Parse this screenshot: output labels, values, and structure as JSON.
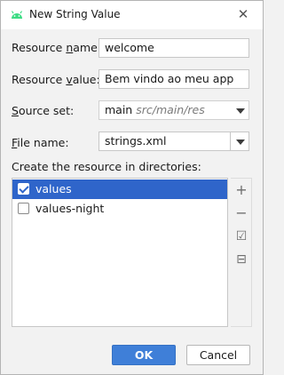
{
  "dialog": {
    "title": "New String Value"
  },
  "form": {
    "resource_name": {
      "label_pre": "Resource ",
      "label_u": "n",
      "label_post": "ame:",
      "value": "welcome"
    },
    "resource_value": {
      "label_pre": "Resource ",
      "label_u": "v",
      "label_post": "alue:",
      "value": "Bem vindo ao meu app"
    },
    "source_set": {
      "label_pre": "",
      "label_u": "S",
      "label_post": "ource set:",
      "value": "main",
      "hint": "src/main/res"
    },
    "file_name": {
      "label_pre": "",
      "label_u": "F",
      "label_post": "ile name:",
      "value": "strings.xml"
    }
  },
  "directories": {
    "label": "Create the resource in directories:",
    "items": [
      {
        "label": "values",
        "checked": true,
        "selected": true
      },
      {
        "label": "values-night",
        "checked": false,
        "selected": false
      }
    ]
  },
  "sidebar": {
    "add": "+",
    "remove": "−",
    "check_all": "☑",
    "uncheck_all": "⊟"
  },
  "buttons": {
    "ok": "OK",
    "cancel": "Cancel"
  },
  "colors": {
    "accent": "#3f7fd8",
    "selection": "#2f65ca",
    "android_green": "#3ddc84"
  },
  "icons": {
    "app": "android-icon",
    "close": "close-icon"
  }
}
